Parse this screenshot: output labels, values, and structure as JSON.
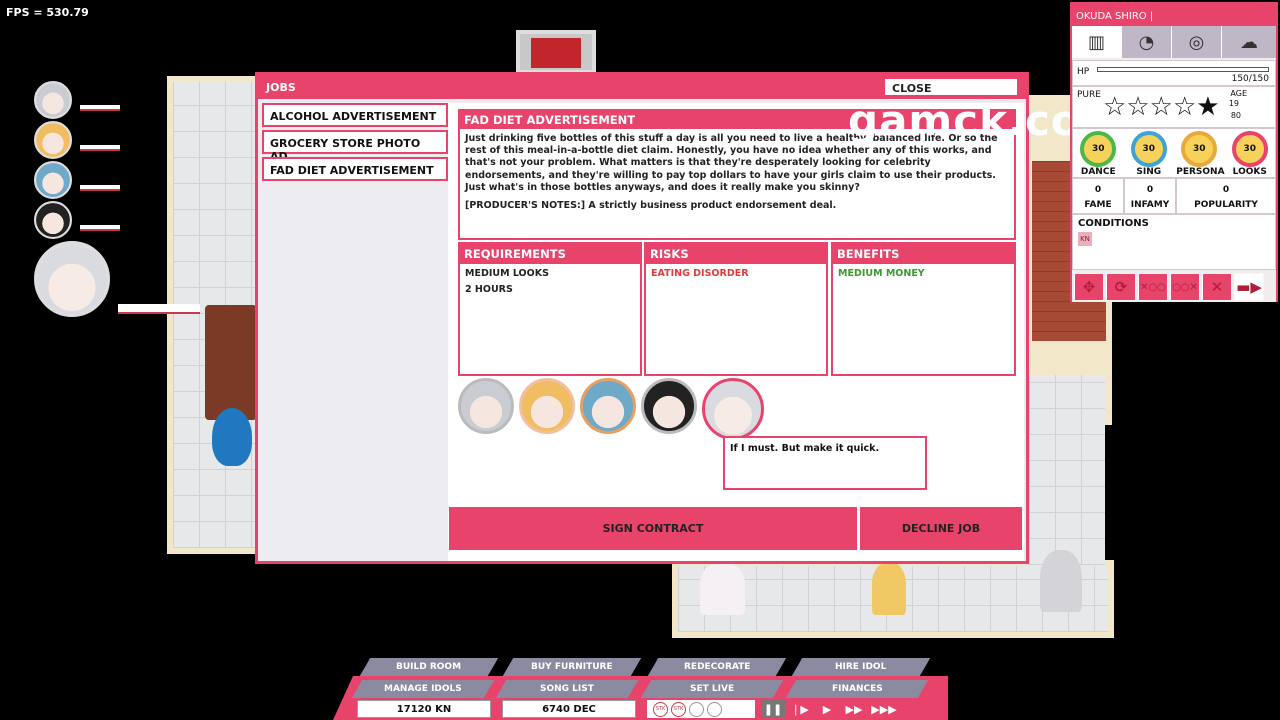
{
  "fps": "FPS = 530.79",
  "watermark": "gamck.com",
  "jobs_window": {
    "title": "JOBS",
    "close_label": "CLOSE",
    "job_list": [
      "ALCOHOL ADVERTISEMENT",
      "GROCERY STORE PHOTO AD",
      "FAD DIET ADVERTISEMENT"
    ],
    "selected": {
      "title": "FAD DIET ADVERTISEMENT",
      "description": "Just drinking five bottles of this stuff a day is all you need to live a healthy, balanced life. Or so the rest of this meal-in-a-bottle diet claim. Honestly, you have no idea whether any of this works, and that's not your problem. What matters is that they're desperately looking for celebrity endorsements, and they're willing to pay top dollars to have your girls claim to use their products. Just what's in those bottles anyways, and does it really make you skinny?",
      "notes": "[PRODUCER'S NOTES:] A strictly business product endorsement deal."
    },
    "requirements": {
      "label": "REQUIREMENTS",
      "items": [
        "MEDIUM LOOKS",
        "2 HOURS"
      ]
    },
    "risks": {
      "label": "RISKS",
      "items": [
        "EATING DISORDER"
      ]
    },
    "benefits": {
      "label": "BENEFITS",
      "items": [
        "MEDIUM MONEY"
      ]
    },
    "speech": "If I must. But make it quick.",
    "sign_label": "SIGN CONTRACT",
    "decline_label": "DECLINE JOB"
  },
  "status": {
    "name": "OKUDA SHIRO",
    "hp_label": "HP",
    "hp_value": "150/150",
    "hp_fraction": 1.0,
    "pure_label": "PURE",
    "stars_filled": 1,
    "stars_total": 5,
    "age_label": "AGE",
    "age": "19",
    "age_extra": "80",
    "skills": [
      {
        "value": "30",
        "label": "DANCE",
        "color": "#4cb848"
      },
      {
        "value": "30",
        "label": "SING",
        "color": "#3ea3d6"
      },
      {
        "value": "30",
        "label": "PERSONA",
        "color": "#e8a93a"
      },
      {
        "value": "30",
        "label": "LOOKS",
        "color": "#e8436b"
      }
    ],
    "fame": {
      "value": "0",
      "label": "FAME"
    },
    "infamy": {
      "value": "0",
      "label": "INFAMY"
    },
    "popularity": {
      "value": "0",
      "label": "POPULARITY"
    },
    "conditions_label": "CONDITIONS",
    "condition_badge": "KN"
  },
  "bottom_menu": {
    "row1": [
      "BUILD ROOM",
      "BUY FURNITURE",
      "REDECORATE",
      "HIRE IDOL"
    ],
    "row2": [
      "MANAGE IDOLS",
      "SONG LIST",
      "SET LIVE",
      "FINANCES"
    ],
    "money1": "17120 KN",
    "money2": "6740 DEC",
    "stk1": "STK",
    "stk2": "STK"
  }
}
